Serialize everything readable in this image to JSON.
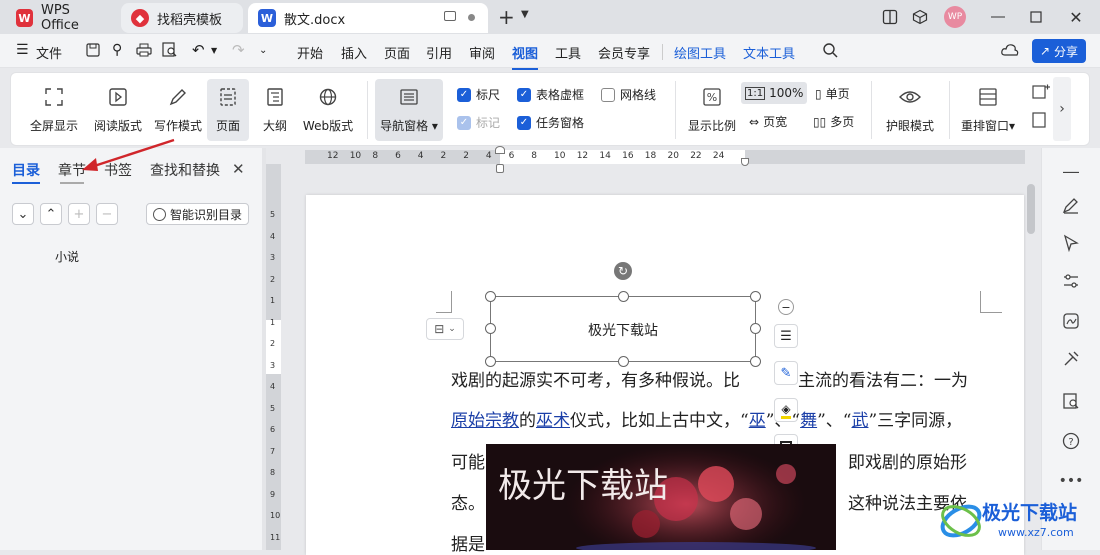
{
  "titlebar": {
    "tabs": [
      {
        "label": "WPS Office"
      },
      {
        "label": "找稻壳模板"
      },
      {
        "label": "散文.docx"
      }
    ],
    "avatar": "WP"
  },
  "menubar": {
    "file": "文件",
    "items": [
      "开始",
      "插入",
      "页面",
      "引用",
      "审阅",
      "视图",
      "工具",
      "会员专享"
    ],
    "extra": [
      "绘图工具",
      "文本工具"
    ],
    "share": "分享"
  },
  "ribbon": {
    "fullscreen": "全屏显示",
    "reading": "阅读版式",
    "writing": "写作模式",
    "page": "页面",
    "outline": "大纲",
    "web": "Web版式",
    "nav_pane": "导航窗格",
    "checks": {
      "ruler": "标尺",
      "table_grid": "表格虚框",
      "gridlines": "网格线",
      "marks": "标记",
      "task_pane": "任务窗格"
    },
    "zoom_label": "显示比例",
    "zoom_100": "100%",
    "page_width": "页宽",
    "single_page": "单页",
    "multi_page": "多页",
    "eye_mode": "护眼模式",
    "rearrange": "重排窗口"
  },
  "leftpane": {
    "tabs": [
      "目录",
      "章节",
      "书签",
      "查找和替换"
    ],
    "smart_toc": "智能识别目录",
    "toc_item": "小说"
  },
  "ruler": {
    "h_ticks": [
      "12",
      "10",
      "8",
      "6",
      "4",
      "2",
      "2",
      "4",
      "6",
      "8",
      "10",
      "12",
      "14",
      "16",
      "18",
      "20",
      "22",
      "24"
    ],
    "v_ticks": [
      "5",
      "4",
      "3",
      "2",
      "1",
      "1",
      "2",
      "3",
      "4",
      "5",
      "6",
      "7",
      "8",
      "9",
      "10",
      "11"
    ]
  },
  "document": {
    "textbox": "极光下载站",
    "line1a": "戏剧的起源实不可考，有多种假说。比",
    "line1b": "主流的看法有二：一为",
    "line2_link1": "原始宗教",
    "line2_t1": "的",
    "line2_link2": "巫术",
    "line2_t2": "仪式，比如上古中文，“",
    "line2_link3": "巫",
    "line2_t3": "”、“",
    "line2_link4": "舞",
    "line2_t4": "”、“",
    "line2_link5": "武",
    "line2_t5": "”三字同源，",
    "line3a": "可能",
    "line3b": "即戏剧的原始形",
    "line4a": "态。",
    "line4b": "这种说法主要依",
    "line5a": "据是",
    "image_text": "极光下载站"
  },
  "watermark": {
    "name": "极光下载站",
    "url": "www.xz7.com"
  },
  "colors": {
    "accent": "#1b5fd8",
    "wps_red": "#e0323c",
    "arrow": "#d0262b"
  }
}
